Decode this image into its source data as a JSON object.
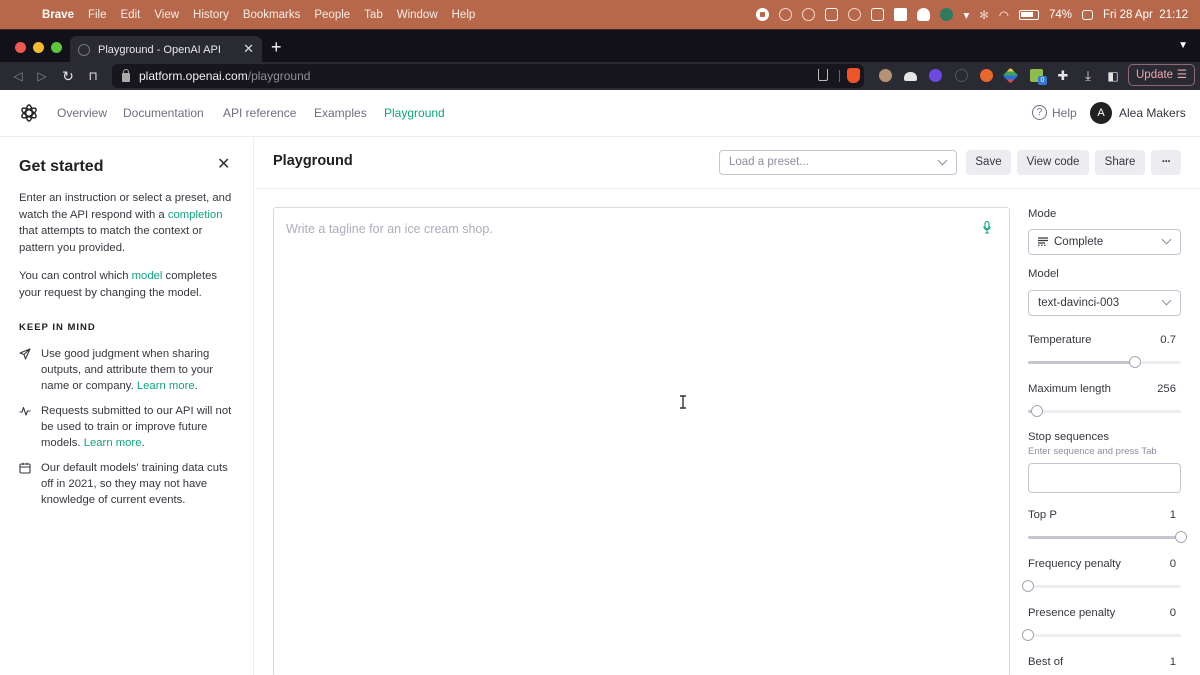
{
  "menubar": {
    "app": "Brave",
    "items": [
      "File",
      "Edit",
      "View",
      "History",
      "Bookmarks",
      "People",
      "Tab",
      "Window",
      "Help"
    ],
    "battery": "74%",
    "datetime": "Fri 28 Apr  21:12"
  },
  "browser": {
    "tab_title": "Playground - OpenAI API",
    "url_host": "platform.openai.com",
    "url_path": "/playground",
    "extension_badge": "0",
    "update_label": "Update",
    "update_menu_glyph": "☰"
  },
  "header": {
    "nav": [
      "Overview",
      "Documentation",
      "API reference",
      "Examples",
      "Playground"
    ],
    "active_nav": "Playground",
    "help_label": "Help",
    "avatar_initial": "A",
    "user_name": "Alea Makers"
  },
  "get_started": {
    "title": "Get started",
    "para1_before": "Enter an instruction or select a preset, and watch the API respond with a ",
    "para1_link": "completion",
    "para1_after": " that attempts to match the context or pattern you provided.",
    "para2_before": "You can control which ",
    "para2_link": "model",
    "para2_after": " completes your request by changing the model.",
    "section_title": "KEEP IN MIND",
    "items": [
      {
        "icon": "send-icon",
        "text": "Use good judgment when sharing outputs, and attribute them to your name or company. ",
        "link": "Learn more",
        "suffix": "."
      },
      {
        "icon": "activity-icon",
        "text": "Requests submitted to our API will not be used to train or improve future models. ",
        "link": "Learn more",
        "suffix": "."
      },
      {
        "icon": "calendar-icon",
        "text": "Our default models' training data cuts off in 2021, so they may not have knowledge of current events.",
        "link": "",
        "suffix": ""
      }
    ]
  },
  "playground": {
    "title": "Playground",
    "preset_placeholder": "Load a preset...",
    "save_label": "Save",
    "view_code_label": "View code",
    "share_label": "Share",
    "more_label": "···",
    "prompt_placeholder": "Write a tagline for an ice cream shop.",
    "prompt_value": ""
  },
  "settings": {
    "mode_label": "Mode",
    "mode_value": "Complete",
    "model_label": "Model",
    "model_value": "text-davinci-003",
    "temperature": {
      "label": "Temperature",
      "value": "0.7",
      "fraction": 0.7
    },
    "max_length": {
      "label": "Maximum length",
      "value": "256",
      "fraction": 0.06
    },
    "stop_sequences": {
      "label": "Stop sequences",
      "hint": "Enter sequence and press Tab",
      "value": ""
    },
    "top_p": {
      "label": "Top P",
      "value": "1",
      "fraction": 1.0
    },
    "frequency_penalty": {
      "label": "Frequency penalty",
      "value": "0",
      "fraction": 0.0
    },
    "presence_penalty": {
      "label": "Presence penalty",
      "value": "0",
      "fraction": 0.0
    },
    "best_of": {
      "label": "Best of",
      "value": "1"
    }
  },
  "colors": {
    "accent": "#10a37f",
    "menubar": "#b8684a",
    "browser_dark": "#2a2a33"
  }
}
